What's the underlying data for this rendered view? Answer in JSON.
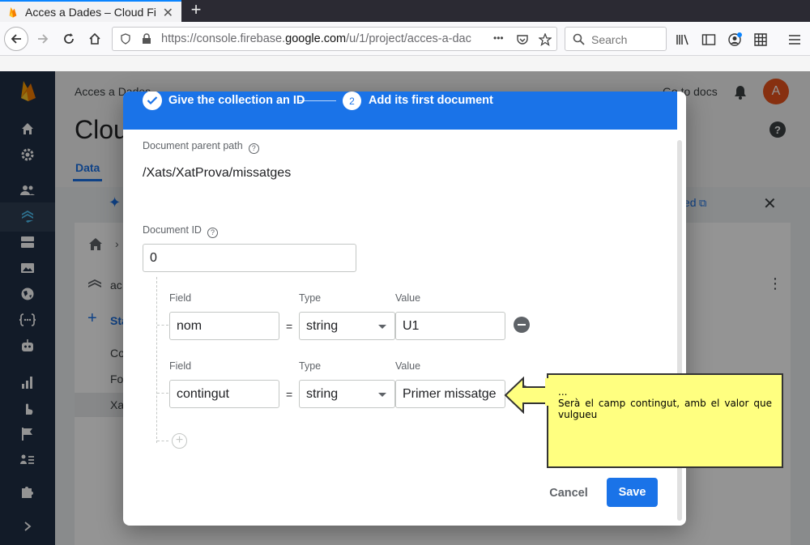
{
  "browser": {
    "tab_title": "Acces a Dades – Cloud Fi",
    "url_prefix": "https://console.firebase.",
    "url_domain": "google.com",
    "url_suffix": "/u/1/project/acces-a-dac",
    "search_placeholder": "Search",
    "more_label": "•••"
  },
  "background": {
    "project_name": "Acces a Dades",
    "page_title": "Cloud",
    "tab_data": "Data",
    "go_to_docs": "Go to docs",
    "avatar_letter": "A",
    "learn_more": "ed",
    "start_collection": "Sta",
    "collection_row": "ac",
    "list_items": [
      "Co",
      "Fo",
      "Xat"
    ]
  },
  "modal": {
    "step1_label": "Give the collection an ID",
    "step2_number": "2",
    "step2_label": "Add its first document",
    "parent_path_label": "Document parent path",
    "parent_path_value": "/Xats/XatProva/missatges",
    "document_id_label": "Document ID",
    "document_id_value": "0",
    "fields": [
      {
        "field_label": "Field",
        "type_label": "Type",
        "value_label": "Value",
        "field": "nom",
        "type": "string",
        "value": "U1"
      },
      {
        "field_label": "Field",
        "type_label": "Type",
        "value_label": "Value",
        "field": "contingut",
        "type": "string",
        "value": "Primer missatge"
      }
    ],
    "equals": "=",
    "cancel_label": "Cancel",
    "save_label": "Save"
  },
  "callout": {
    "line1": "...",
    "line2": "Serà el camp contingut, amb el valor que vulgueu"
  },
  "colors": {
    "firebase_blue": "#1a73e8",
    "rail": "#1f2f45",
    "callout_fill": "#ffff80"
  }
}
